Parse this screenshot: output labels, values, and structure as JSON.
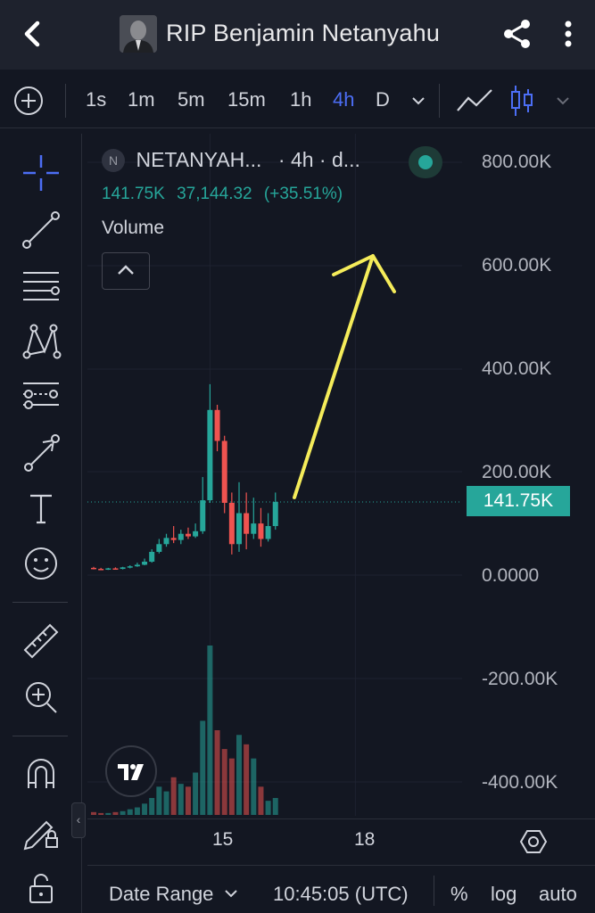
{
  "header": {
    "title": "RIP Benjamin Netanyahu",
    "back_icon": "back-arrow-icon",
    "share_icon": "share-icon",
    "more_icon": "more-vertical-icon"
  },
  "timeframes": {
    "items": [
      "1s",
      "1m",
      "5m",
      "15m",
      "1h",
      "4h",
      "D"
    ],
    "active": "4h",
    "active_color": "#4c6ef5"
  },
  "legend": {
    "badge": "N",
    "symbol": "NETANYAH...",
    "meta": "· 4h · d...",
    "last": "141.75K",
    "change": "37,144.32",
    "change_pct": "(+35.51%)",
    "volume_label": "Volume"
  },
  "price_scale": {
    "labels": [
      "800.00K",
      "600.00K",
      "400.00K",
      "200.00K",
      "0.0000",
      "-200.00K",
      "-400.00K"
    ],
    "last_price": "141.75K",
    "last_price_color": "#26a69a"
  },
  "x_axis": {
    "labels": [
      "15",
      "18"
    ]
  },
  "bottom_bar": {
    "date_range": "Date Range",
    "clock": "10:45:05 (UTC)",
    "percent": "%",
    "log": "log",
    "auto": "auto"
  },
  "colors": {
    "up": "#26a69a",
    "down": "#ef5350",
    "background": "#131722",
    "annotation": "#f5ec5a"
  },
  "chart_data": {
    "type": "candlestick",
    "interval": "4h",
    "y_unit": "price",
    "ylim": [
      -480000,
      820000
    ],
    "candles": [
      {
        "o": 14000,
        "h": 16000,
        "l": 11000,
        "c": 12000
      },
      {
        "o": 12000,
        "h": 14000,
        "l": 10000,
        "c": 11000
      },
      {
        "o": 11000,
        "h": 14000,
        "l": 10000,
        "c": 13000
      },
      {
        "o": 13000,
        "h": 15000,
        "l": 11000,
        "c": 12000
      },
      {
        "o": 12000,
        "h": 16000,
        "l": 11000,
        "c": 15000
      },
      {
        "o": 15000,
        "h": 19000,
        "l": 13000,
        "c": 17000
      },
      {
        "o": 17000,
        "h": 24000,
        "l": 16000,
        "c": 20000
      },
      {
        "o": 20000,
        "h": 32000,
        "l": 19000,
        "c": 26000
      },
      {
        "o": 26000,
        "h": 50000,
        "l": 24000,
        "c": 45000
      },
      {
        "o": 45000,
        "h": 70000,
        "l": 42000,
        "c": 60000
      },
      {
        "o": 60000,
        "h": 80000,
        "l": 55000,
        "c": 72000
      },
      {
        "o": 72000,
        "h": 95000,
        "l": 62000,
        "c": 68000
      },
      {
        "o": 68000,
        "h": 88000,
        "l": 60000,
        "c": 80000
      },
      {
        "o": 80000,
        "h": 92000,
        "l": 70000,
        "c": 75000
      },
      {
        "o": 75000,
        "h": 100000,
        "l": 72000,
        "c": 85000
      },
      {
        "o": 85000,
        "h": 190000,
        "l": 80000,
        "c": 145000
      },
      {
        "o": 145000,
        "h": 370000,
        "l": 140000,
        "c": 320000
      },
      {
        "o": 320000,
        "h": 330000,
        "l": 240000,
        "c": 260000
      },
      {
        "o": 260000,
        "h": 270000,
        "l": 120000,
        "c": 140000
      },
      {
        "o": 140000,
        "h": 160000,
        "l": 40000,
        "c": 60000
      },
      {
        "o": 60000,
        "h": 180000,
        "l": 45000,
        "c": 120000
      },
      {
        "o": 120000,
        "h": 160000,
        "l": 50000,
        "c": 80000
      },
      {
        "o": 80000,
        "h": 150000,
        "l": 70000,
        "c": 100000
      },
      {
        "o": 100000,
        "h": 130000,
        "l": 55000,
        "c": 70000
      },
      {
        "o": 70000,
        "h": 120000,
        "l": 65000,
        "c": 95000
      },
      {
        "o": 95000,
        "h": 160000,
        "l": 88000,
        "c": 141750
      }
    ],
    "volume": [
      3,
      2,
      2,
      3,
      4,
      6,
      8,
      12,
      18,
      30,
      25,
      40,
      33,
      30,
      45,
      100,
      180,
      90,
      70,
      60,
      85,
      75,
      60,
      30,
      15,
      18
    ],
    "x_labels": [
      {
        "label": "15",
        "index": 16
      },
      {
        "label": "18",
        "index": 36
      }
    ],
    "annotation": "arrow"
  }
}
